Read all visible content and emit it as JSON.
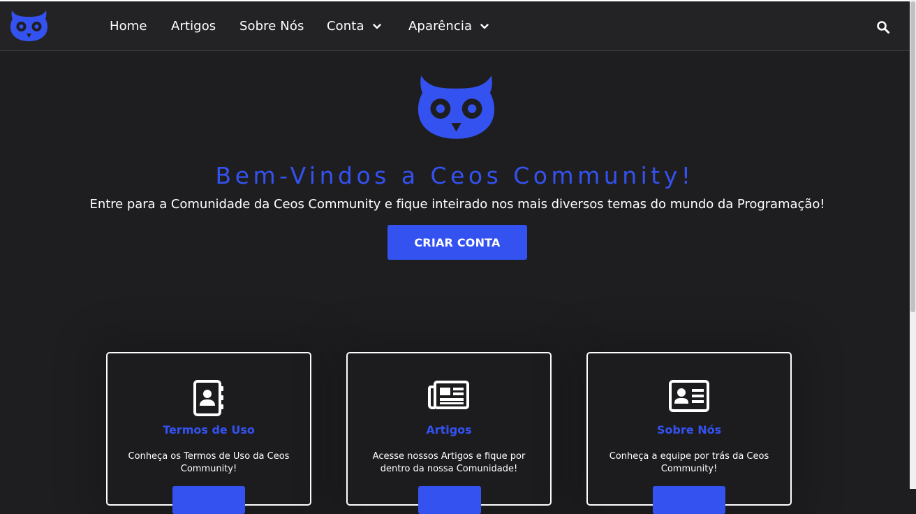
{
  "nav": {
    "logo": "owl-logo",
    "items": [
      {
        "label": "Home"
      },
      {
        "label": "Artigos"
      },
      {
        "label": "Sobre Nós"
      },
      {
        "label": "Conta",
        "dropdown": true
      },
      {
        "label": "Aparência",
        "dropdown": true
      }
    ],
    "search_icon": "search-icon"
  },
  "hero": {
    "logo": "owl-logo",
    "title": "Bem-Vindos a Ceos Community!",
    "subtitle": "Entre para a Comunidade da Ceos Community e fique inteirado nos mais diversos temas do mundo da Programação!",
    "cta_label": "CRIAR CONTA"
  },
  "cards": [
    {
      "icon": "address-book-icon",
      "title": "Termos de Uso",
      "description": "Conheça os Termos de Uso da Ceos Community!"
    },
    {
      "icon": "newspaper-icon",
      "title": "Artigos",
      "description": "Acesse nossos Artigos e fique por dentro da nossa Comunidade!"
    },
    {
      "icon": "id-card-icon",
      "title": "Sobre Nós",
      "description": "Conheça a equipe por trás da Ceos Community!"
    }
  ],
  "colors": {
    "accent": "#3452f0",
    "background": "#1e1e21",
    "navbar": "#232326",
    "text": "#ffffff"
  }
}
